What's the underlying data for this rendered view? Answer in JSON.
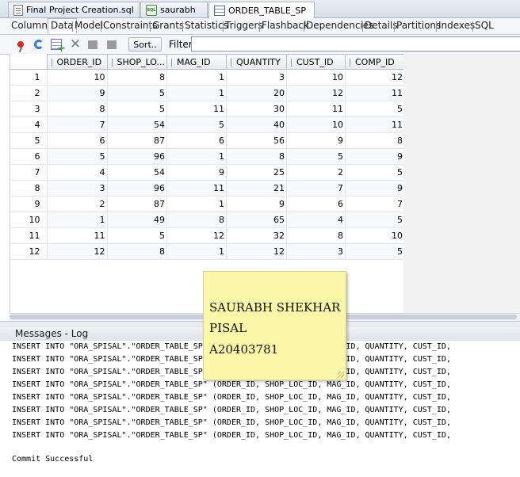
{
  "file_tabs": [
    {
      "label": "Final Project Creation.sql",
      "icon": "sql-file-icon"
    },
    {
      "label": "saurabh",
      "icon": "sql-worksheet-icon"
    },
    {
      "label": "ORDER_TABLE_SP",
      "icon": "table-icon"
    }
  ],
  "sub_tabs": [
    "Columns",
    "Data",
    "Model",
    "Constraints",
    "Grants",
    "Statistics",
    "Triggers",
    "Flashback",
    "Dependencies",
    "Details",
    "Partitions",
    "Indexes",
    "SQL"
  ],
  "toolbar": {
    "sort_label": "Sort..",
    "filter_label": "Filter:",
    "filter_value": ""
  },
  "grid": {
    "columns": [
      "ORDER_ID",
      "SHOP_LO...",
      "MAG_ID",
      "QUANTITY",
      "CUST_ID",
      "COMP_ID"
    ],
    "rows": [
      [
        "1",
        "10",
        "8",
        "1",
        "3",
        "10",
        "12"
      ],
      [
        "2",
        "9",
        "5",
        "1",
        "20",
        "12",
        "11"
      ],
      [
        "3",
        "8",
        "5",
        "11",
        "30",
        "11",
        "5"
      ],
      [
        "4",
        "7",
        "54",
        "5",
        "40",
        "10",
        "11"
      ],
      [
        "5",
        "6",
        "87",
        "6",
        "56",
        "9",
        "8"
      ],
      [
        "6",
        "5",
        "96",
        "1",
        "8",
        "5",
        "9"
      ],
      [
        "7",
        "4",
        "54",
        "9",
        "25",
        "2",
        "5"
      ],
      [
        "8",
        "3",
        "96",
        "11",
        "21",
        "7",
        "9"
      ],
      [
        "9",
        "2",
        "87",
        "1",
        "9",
        "6",
        "7"
      ],
      [
        "10",
        "1",
        "49",
        "8",
        "65",
        "4",
        "5"
      ],
      [
        "11",
        "11",
        "5",
        "12",
        "32",
        "8",
        "10"
      ],
      [
        "12",
        "12",
        "8",
        "1",
        "12",
        "3",
        "5"
      ]
    ]
  },
  "messages": {
    "title": "Messages - Log",
    "lines": [
      "INSERT INTO \"ORA_SPISAL\".\"ORDER_TABLE_SP\" (ORDER_ID, SHOP_LOC_ID, MAG_ID, QUANTITY, CUST_ID,",
      "INSERT INTO \"ORA_SPISAL\".\"ORDER_TABLE_SP\" (ORDER_ID, SHOP_LOC_ID, MAG_ID, QUANTITY, CUST_ID,",
      "INSERT INTO \"ORA_SPISAL\".\"ORDER_TABLE_SP\" (ORDER_ID, SHOP_LOC_ID, MAG_ID, QUANTITY, CUST_ID,",
      "INSERT INTO \"ORA_SPISAL\".\"ORDER_TABLE_SP\" (ORDER_ID, SHOP_LOC_ID, MAG_ID, QUANTITY, CUST_ID,",
      "INSERT INTO \"ORA_SPISAL\".\"ORDER_TABLE_SP\" (ORDER_ID, SHOP_LOC_ID, MAG_ID, QUANTITY, CUST_ID,",
      "INSERT INTO \"ORA_SPISAL\".\"ORDER_TABLE_SP\" (ORDER_ID, SHOP_LOC_ID, MAG_ID, QUANTITY, CUST_ID,",
      "INSERT INTO \"ORA_SPISAL\".\"ORDER_TABLE_SP\" (ORDER_ID, SHOP_LOC_ID, MAG_ID, QUANTITY, CUST_ID,",
      "INSERT INTO \"ORA_SPISAL\".\"ORDER_TABLE_SP\" (ORDER_ID, SHOP_LOC_ID, MAG_ID, QUANTITY, CUST_ID,",
      "",
      "Commit Successful"
    ]
  },
  "sticky_note": {
    "lines": [
      "SAURABH SHEKHAR",
      "PISAL",
      "A20403781"
    ]
  }
}
